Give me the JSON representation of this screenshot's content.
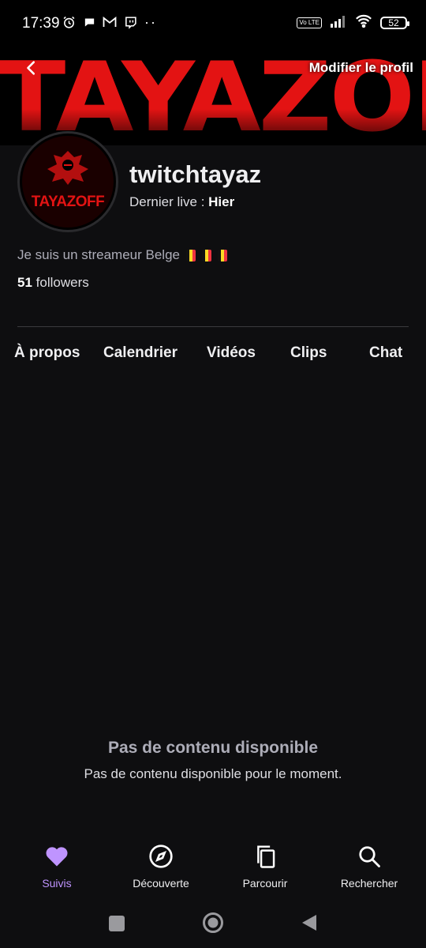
{
  "status_bar": {
    "time": "17:39",
    "volte": "Vo LTE",
    "battery": "52"
  },
  "header": {
    "banner_text": "TAYAZOFF",
    "edit_profile_label": "Modifier le profil"
  },
  "profile": {
    "avatar_text": "TAYAZOFF",
    "username": "twitchtayaz",
    "last_live_label": "Dernier live :",
    "last_live_value": "Hier",
    "bio": "Je suis un streameur Belge",
    "followers_count": "51",
    "followers_label": "followers"
  },
  "tabs": [
    {
      "label": "À propos"
    },
    {
      "label": "Calendrier"
    },
    {
      "label": "Vidéos"
    },
    {
      "label": "Clips"
    },
    {
      "label": "Chat"
    }
  ],
  "empty_state": {
    "title": "Pas de contenu disponible",
    "subtitle": "Pas de contenu disponible pour le moment."
  },
  "bottom_nav": [
    {
      "label": "Suivis",
      "icon": "heart-icon",
      "active": true
    },
    {
      "label": "Découverte",
      "icon": "compass-icon",
      "active": false
    },
    {
      "label": "Parcourir",
      "icon": "browse-icon",
      "active": false
    },
    {
      "label": "Rechercher",
      "icon": "search-icon",
      "active": false
    }
  ],
  "colors": {
    "accent": "#bf94ff",
    "brand_red": "#e31313",
    "background": "#0e0e10"
  }
}
